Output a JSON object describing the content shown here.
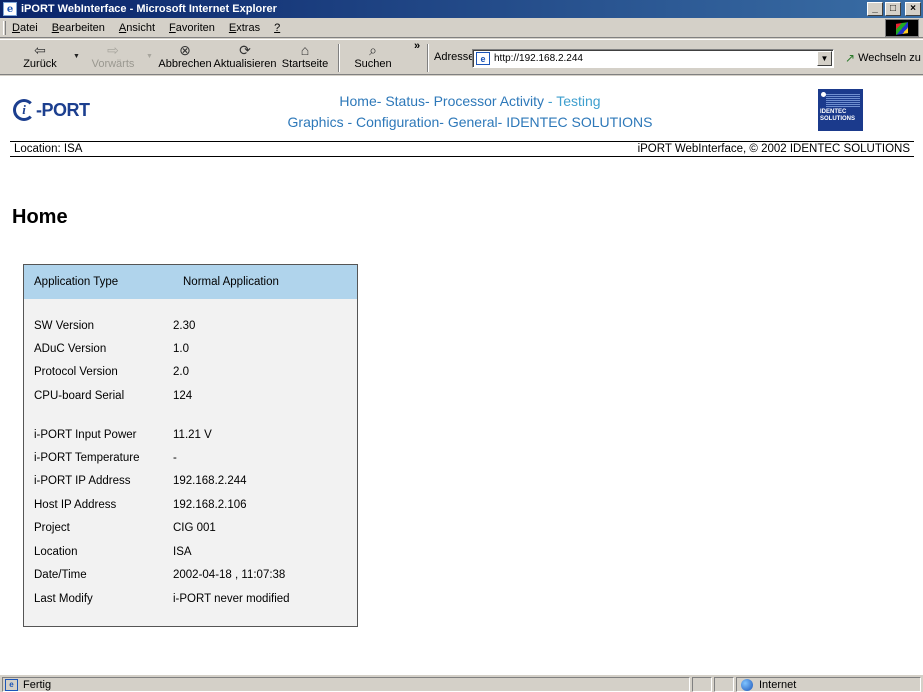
{
  "window": {
    "title": "iPORT WebInterface - Microsoft Internet Explorer",
    "min": "_",
    "max": "□",
    "close": "×"
  },
  "menu": {
    "items": [
      {
        "ul": "D",
        "rest": "atei"
      },
      {
        "ul": "B",
        "rest": "earbeiten"
      },
      {
        "ul": "A",
        "rest": "nsicht"
      },
      {
        "ul": "F",
        "rest": "avoriten"
      },
      {
        "ul": "E",
        "rest": "xtras"
      },
      {
        "ul": "?",
        "rest": ""
      }
    ]
  },
  "toolbar": {
    "back": "Zurück",
    "forward": "Vorwärts",
    "stop": "Abbrechen",
    "refresh": "Aktualisieren",
    "home": "Startseite",
    "search": "Suchen",
    "more": "»",
    "address_label": "Adresse",
    "address_value": "http://192.168.2.244",
    "go": "Wechseln zu"
  },
  "page": {
    "logo_text": "-PORT",
    "logo_i": "i",
    "nav_line1": [
      {
        "label": "Home",
        "dim": false
      },
      {
        "label": "- Status",
        "dim": false
      },
      {
        "label": "- Processor Activity",
        "dim": false
      },
      {
        "label": " - Testing",
        "dim": true
      }
    ],
    "nav_line2": [
      {
        "label": "Graphics",
        "dim": false
      },
      {
        "label": " - Configuration",
        "dim": false
      },
      {
        "label": "- General",
        "dim": false
      },
      {
        "label": "- IDENTEC SOLUTIONS",
        "dim": false
      }
    ],
    "company_logo_line1": "IDENTEC",
    "company_logo_line2": "SOLUTIONS",
    "location": "Location: ISA",
    "copyright": "iPORT WebInterface, © 2002 IDENTEC SOLUTIONS",
    "title": "Home",
    "table_head": {
      "key": "Application Type",
      "value": "Normal Application"
    },
    "rows": [
      {
        "key": "SW Version",
        "value": "2.30"
      },
      {
        "key": "ADuC Version",
        "value": "1.0"
      },
      {
        "key": "Protocol Version",
        "value": "2.0"
      },
      {
        "key": "CPU-board Serial",
        "value": "124"
      },
      {
        "key": "i-PORT Input Power",
        "value": "11.21 V"
      },
      {
        "key": "i-PORT Temperature",
        "value": "-"
      },
      {
        "key": "i-PORT IP Address",
        "value": "192.168.2.244"
      },
      {
        "key": "Host IP Address",
        "value": "192.168.2.106"
      },
      {
        "key": "Project",
        "value": "CIG 001"
      },
      {
        "key": "Location",
        "value": "ISA"
      },
      {
        "key": "Date/Time",
        "value": "2002-04-18 , 11:07:38"
      },
      {
        "key": "Last Modify",
        "value": "i-PORT never modified"
      }
    ]
  },
  "status": {
    "text": "Fertig",
    "zone": "Internet"
  }
}
